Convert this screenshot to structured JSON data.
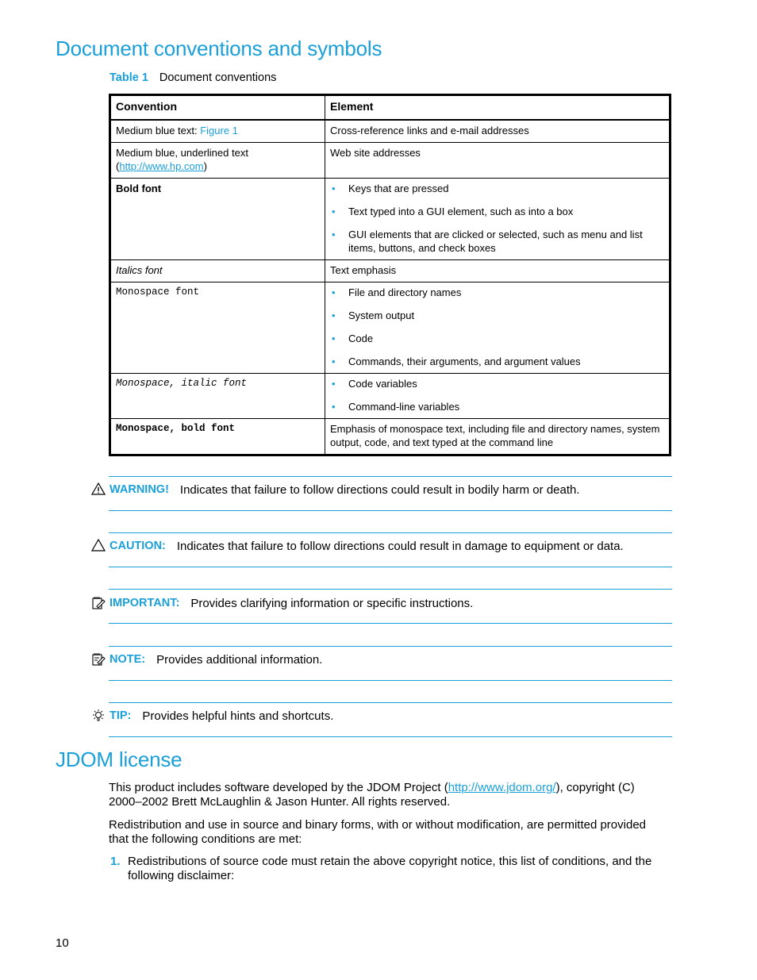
{
  "section1": {
    "title": "Document conventions and symbols",
    "table_caption_label": "Table 1",
    "table_caption_text": "Document conventions"
  },
  "table": {
    "headers": [
      "Convention",
      "Element"
    ],
    "rows": [
      {
        "convention_prefix": "Medium blue text: ",
        "convention_link": "Figure 1",
        "element": "Cross-reference links and e-mail addresses"
      },
      {
        "convention_prefix": "Medium blue, underlined text",
        "convention_link": "http://www.hp.com",
        "element": "Web site addresses"
      },
      {
        "convention": "Bold font",
        "element_items": [
          "Keys that are pressed",
          "Text typed into a GUI element, such as into a box",
          "GUI elements that are clicked or selected, such as menu and list items, buttons, and check boxes"
        ]
      },
      {
        "convention": "Italics font",
        "element": "Text emphasis"
      },
      {
        "convention": "Monospace font",
        "element_items": [
          "File and directory names",
          "System output",
          "Code",
          "Commands, their arguments, and argument values"
        ]
      },
      {
        "convention": "Monospace, italic font",
        "element_items": [
          "Code variables",
          "Command-line variables"
        ]
      },
      {
        "convention": "Monospace, bold font",
        "element": "Emphasis of monospace text, including file and directory names, system output, code, and text typed at the command line"
      }
    ],
    "bullet": "•"
  },
  "notices": [
    {
      "icon": "warning-icon",
      "tag": "WARNING!",
      "text": "Indicates that failure to follow directions could result in bodily harm or death."
    },
    {
      "icon": "caution-icon",
      "tag": "CAUTION:",
      "text": "Indicates that failure to follow directions could result in damage to equipment or data."
    },
    {
      "icon": "important-icon",
      "tag": "IMPORTANT:",
      "text": "Provides clarifying information or specific instructions."
    },
    {
      "icon": "note-icon",
      "tag": "NOTE:",
      "text": "Provides additional information."
    },
    {
      "icon": "tip-icon",
      "tag": "TIP:",
      "text": "Provides helpful hints and shortcuts."
    }
  ],
  "section2": {
    "title": "JDOM license",
    "para1_before": "This product includes software developed by the JDOM Project (",
    "para1_link": "http://www.jdom.org/",
    "para1_after": "), copyright (C) 2000–2002 Brett McLaughlin & Jason Hunter. All rights reserved.",
    "para2": "Redistribution and use in source and binary forms, with or without modification, are permitted provided that the following conditions are met:",
    "list": [
      {
        "num": "1.",
        "text": "Redistributions of source code must retain the above copyright notice, this list of conditions, and the following disclaimer:"
      }
    ]
  },
  "footer": {
    "page_number": "10"
  },
  "colors": {
    "accent": "#1a9fd9",
    "text": "#000000"
  }
}
